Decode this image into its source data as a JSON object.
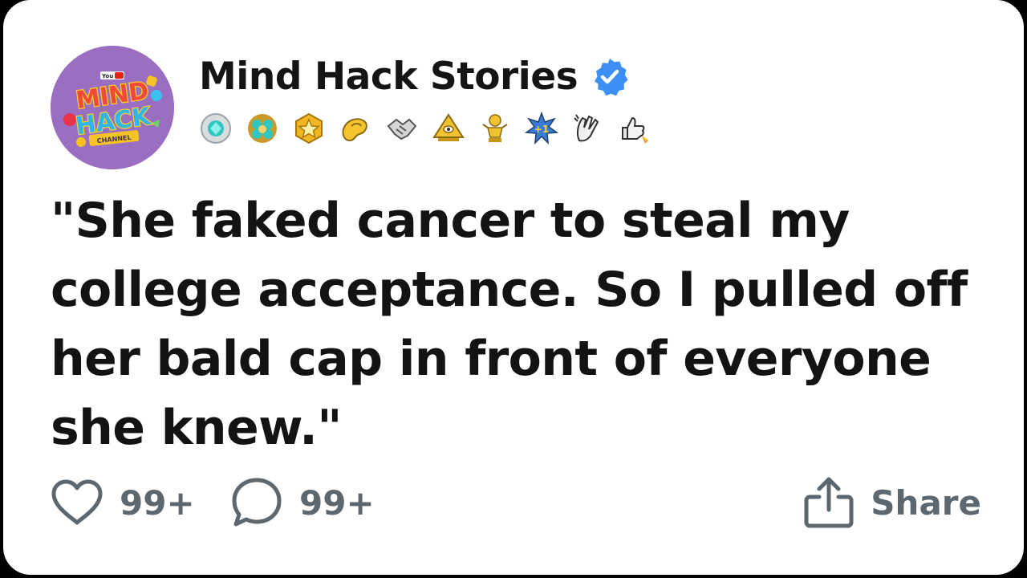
{
  "post": {
    "channel_name": "Mind Hack Stories",
    "verified": true,
    "avatar": {
      "logo_lines": [
        "YouTube",
        "MIND",
        "HACK",
        "CHANNEL"
      ],
      "background_color": "#9a6fc2"
    },
    "badges": [
      "turquoise-gem-badge-icon",
      "gem-cluster-badge-icon",
      "gold-star-badge-icon",
      "yellow-hand-badge-icon",
      "handshake-badge-icon",
      "gold-pyramid-badge-icon",
      "gold-trophy-figure-badge-icon",
      "plus-one-burst-badge-icon",
      "clapping-hands-badge-icon",
      "thumbs-up-rocket-badge-icon"
    ],
    "text": "\"She faked cancer to steal my college acceptance. So I pulled off her bald cap in front of everyone she knew.\"",
    "likes": "99+",
    "comments": "99+",
    "share_label": "Share"
  },
  "colors": {
    "verified_blue": "#3d8ff5",
    "action_gray": "#5c6770",
    "text": "#131313"
  }
}
